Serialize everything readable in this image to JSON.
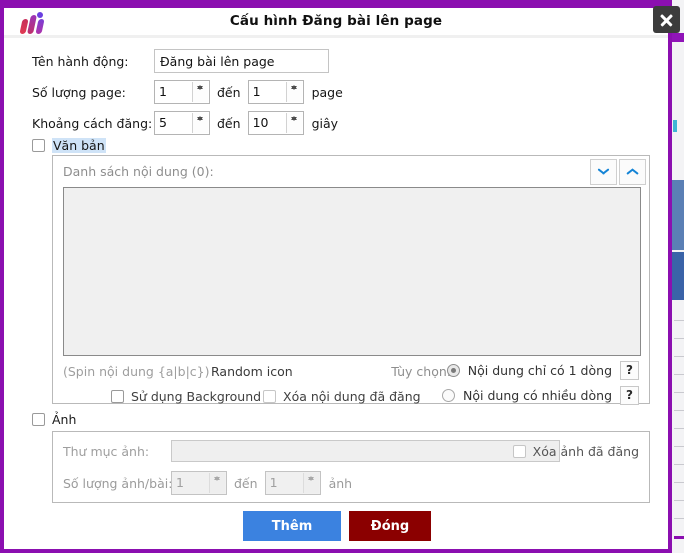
{
  "window": {
    "title": "Cấu hình Đăng bài lên page",
    "logo_name": "app-logo",
    "close_icon": "close-icon",
    "frame_color": "#8b0fb0"
  },
  "form": {
    "action_name": {
      "label": "Tên hành động:",
      "value": "Đăng bài lên page"
    },
    "page_count": {
      "label": "Số lượng page:",
      "from": "1",
      "between": "đến",
      "to": "1",
      "unit": "page"
    },
    "interval": {
      "label": "Khoảng cách đăng:",
      "from": "5",
      "between": "đến",
      "to": "10",
      "unit": "giây"
    }
  },
  "text_section": {
    "checkbox_label": "Văn bản",
    "checked": false,
    "content_list_label": "Danh sách nội dung (0):",
    "chevron_down_icon": "chevron-down-icon",
    "chevron_up_icon": "chevron-up-icon",
    "listbox_value": "",
    "spin_hint": "(Spin nội dung {a|b|c})",
    "random_icon_label": "Random icon",
    "use_background": {
      "label": "Sử dụng Background",
      "checked": false
    },
    "delete_posted": {
      "label": "Xóa nội dung đã đăng",
      "checked": false
    },
    "options_label": "Tùy chọn:",
    "radios": [
      {
        "label": "Nội dung chỉ có 1 dòng",
        "checked": true,
        "help": "?"
      },
      {
        "label": "Nội dung có nhiều dòng",
        "checked": false,
        "help": "?"
      }
    ]
  },
  "image_section": {
    "checkbox_label": "Ảnh",
    "checked": false,
    "folder": {
      "label": "Thư mục ảnh:",
      "value": "",
      "placeholder": ""
    },
    "delete_posted_image": {
      "label": "Xóa ảnh đã đăng",
      "checked": false
    },
    "image_count": {
      "label": "Số lượng ảnh/bài:",
      "from": "1",
      "between": "đến",
      "to": "1",
      "unit": "ảnh"
    }
  },
  "footer": {
    "add_label": "Thêm",
    "add_color": "#3b82e0",
    "close_label": "Đóng",
    "close_color": "#8b0000"
  }
}
